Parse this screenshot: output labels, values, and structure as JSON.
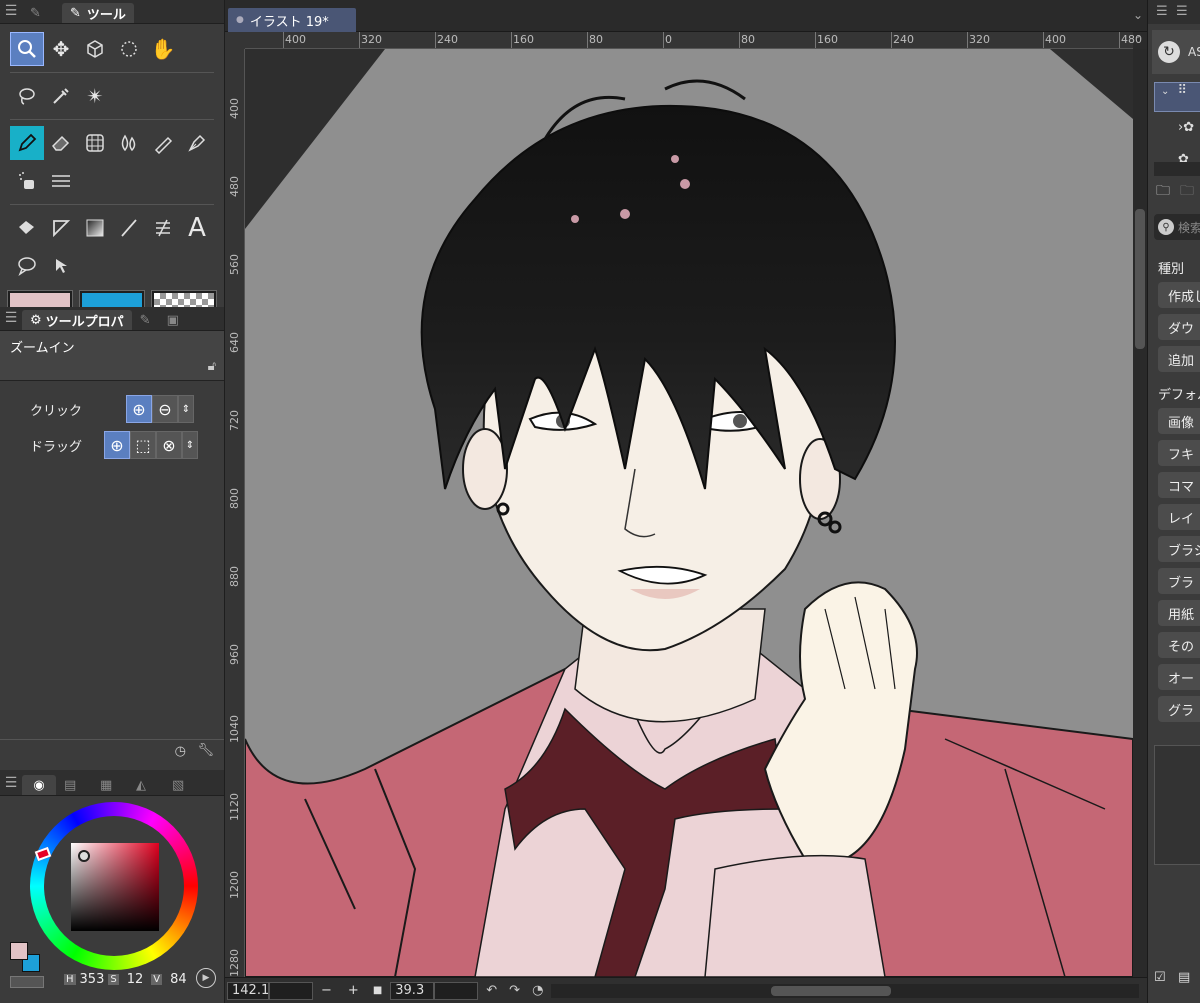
{
  "tool_panel": {
    "tab_label": "ツール",
    "tools_row1": [
      "zoom-icon",
      "move-icon",
      "object-icon",
      "lasso-rotate-icon",
      "hand-icon"
    ],
    "tools_row2": [
      "lasso-icon",
      "eyedropper-icon",
      "magic-wand-icon"
    ],
    "tools_row3": [
      "pen-icon",
      "eraser-icon",
      "grid-icon",
      "blend-icon",
      "airbrush-icon",
      "marker-icon"
    ],
    "tools_row5": [
      "fill-icon",
      "gradient-ruler-icon",
      "gradient-icon",
      "line-icon",
      "frame-icon",
      "text-icon"
    ],
    "text_tool_glyph": "A"
  },
  "colors": {
    "main": "#e2c3c6",
    "sub": "#1da0d9",
    "accent": "#5b7fc0"
  },
  "tool_property": {
    "tab_label": "ツールプロパ",
    "title": "ズームイン",
    "click_label": "クリック",
    "drag_label": "ドラッグ"
  },
  "color_panel": {
    "h_label": "H",
    "h_value": "353",
    "s_label": "S",
    "s_value": "12",
    "v_label": "V",
    "v_value": "84"
  },
  "document": {
    "tab_title": "イラスト 19*"
  },
  "ruler": {
    "h_ticks": [
      "400",
      "320",
      "240",
      "160",
      "80",
      "0",
      "80",
      "160",
      "240",
      "320",
      "400",
      "480"
    ],
    "v_ticks": [
      "400",
      "480",
      "560",
      "640",
      "720",
      "800",
      "880",
      "960",
      "1040",
      "1120",
      "1200",
      "1280"
    ]
  },
  "status": {
    "zoom": "142.1",
    "rotation": "39.3",
    "minus": "−",
    "plus": "+"
  },
  "right_panel": {
    "header": "AS",
    "search": "検索",
    "category_label": "種別",
    "category_items": [
      "作成し",
      "ダウ",
      "追加"
    ],
    "default_label": "デフォル",
    "default_items": [
      "画像",
      "フキ",
      "コマ",
      "レイ",
      "ブラシ",
      "ブラ",
      "用紙",
      "その",
      "オー",
      "グラ"
    ]
  }
}
